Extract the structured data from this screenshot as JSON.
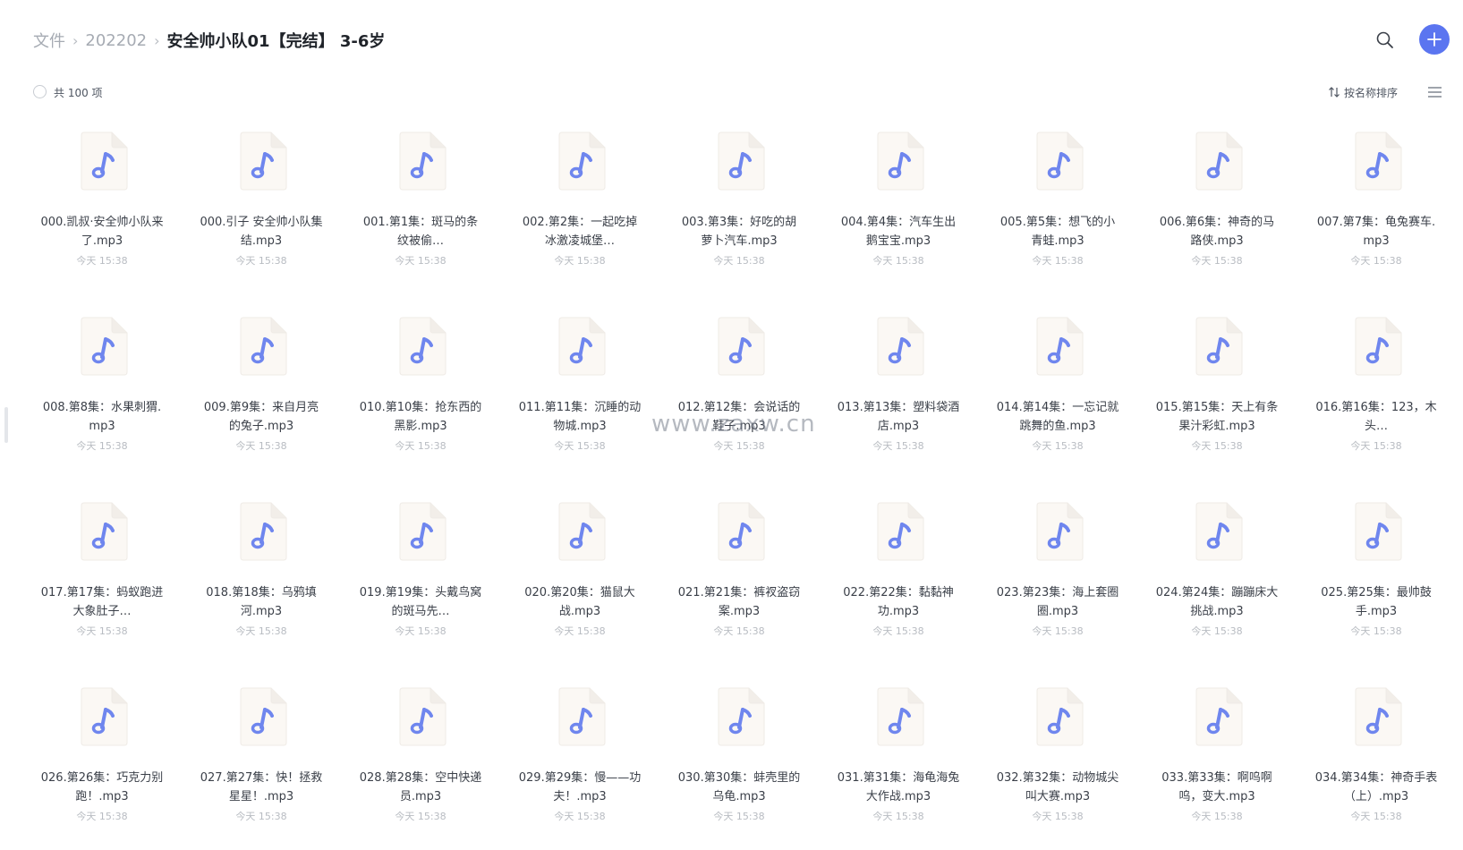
{
  "breadcrumb": {
    "items": [
      "文件",
      "202202"
    ],
    "separator": "›",
    "current": "安全帅小队01【完结】 3-6岁"
  },
  "toolbar": {
    "count_label": "共 100 项",
    "sort_label": "按名称排序"
  },
  "icons": {
    "search": "search-icon",
    "add": "plus-icon",
    "sort": "sort-arrows-icon",
    "view": "list-view-icon",
    "file": "music-note-icon"
  },
  "colors": {
    "accent": "#5b75f0",
    "music_note": "#6f86ee",
    "file_bg": "#fbf8f4"
  },
  "watermark": "www.zaxw.cn",
  "files": [
    {
      "name": "000.凯叔·安全帅小队来了.mp3",
      "time": "今天 15:38"
    },
    {
      "name": "000.引子 安全帅小队集结.mp3",
      "time": "今天 15:38"
    },
    {
      "name": "001.第1集：斑马的条纹被偷…",
      "time": "今天 15:38"
    },
    {
      "name": "002.第2集：一起吃掉冰激凌城堡…",
      "time": "今天 15:38"
    },
    {
      "name": "003.第3集：好吃的胡萝卜汽车.mp3",
      "time": "今天 15:38"
    },
    {
      "name": "004.第4集：汽车生出鹅宝宝.mp3",
      "time": "今天 15:38"
    },
    {
      "name": "005.第5集：想飞的小青蛙.mp3",
      "time": "今天 15:38"
    },
    {
      "name": "006.第6集：神奇的马路侠.mp3",
      "time": "今天 15:38"
    },
    {
      "name": "007.第7集：龟兔赛车.mp3",
      "time": "今天 15:38"
    },
    {
      "name": "008.第8集：水果刺猬.mp3",
      "time": "今天 15:38"
    },
    {
      "name": "009.第9集：来自月亮的兔子.mp3",
      "time": "今天 15:38"
    },
    {
      "name": "010.第10集：抢东西的黑影.mp3",
      "time": "今天 15:38"
    },
    {
      "name": "011.第11集：沉睡的动物城.mp3",
      "time": "今天 15:38"
    },
    {
      "name": "012.第12集：会说话的鞋子.mp3",
      "time": "今天 15:38"
    },
    {
      "name": "013.第13集：塑料袋酒店.mp3",
      "time": "今天 15:38"
    },
    {
      "name": "014.第14集：一忘记就跳舞的鱼.mp3",
      "time": "今天 15:38"
    },
    {
      "name": "015.第15集：天上有条果汁彩虹.mp3",
      "time": "今天 15:38"
    },
    {
      "name": "016.第16集：123，木头…",
      "time": "今天 15:38"
    },
    {
      "name": "017.第17集：蚂蚁跑进大象肚子…",
      "time": "今天 15:38"
    },
    {
      "name": "018.第18集：乌鸦填河.mp3",
      "time": "今天 15:38"
    },
    {
      "name": "019.第19集：头戴鸟窝的斑马先…",
      "time": "今天 15:38"
    },
    {
      "name": "020.第20集：猫鼠大战.mp3",
      "time": "今天 15:38"
    },
    {
      "name": "021.第21集：裤衩盗窃案.mp3",
      "time": "今天 15:38"
    },
    {
      "name": "022.第22集：黏黏神功.mp3",
      "time": "今天 15:38"
    },
    {
      "name": "023.第23集：海上套圈圈.mp3",
      "time": "今天 15:38"
    },
    {
      "name": "024.第24集：蹦蹦床大挑战.mp3",
      "time": "今天 15:38"
    },
    {
      "name": "025.第25集：最帅鼓手.mp3",
      "time": "今天 15:38"
    },
    {
      "name": "026.第26集：巧克力别跑！.mp3",
      "time": "今天 15:38"
    },
    {
      "name": "027.第27集：快！拯救星星！.mp3",
      "time": "今天 15:38"
    },
    {
      "name": "028.第28集：空中快递员.mp3",
      "time": "今天 15:38"
    },
    {
      "name": "029.第29集：慢——功夫！.mp3",
      "time": "今天 15:38"
    },
    {
      "name": "030.第30集：蚌壳里的乌龟.mp3",
      "time": "今天 15:38"
    },
    {
      "name": "031.第31集：海龟海兔大作战.mp3",
      "time": "今天 15:38"
    },
    {
      "name": "032.第32集：动物城尖叫大赛.mp3",
      "time": "今天 15:38"
    },
    {
      "name": "033.第33集：啊呜啊呜，变大.mp3",
      "time": "今天 15:38"
    },
    {
      "name": "034.第34集：神奇手表（上）.mp3",
      "time": "今天 15:38"
    }
  ]
}
